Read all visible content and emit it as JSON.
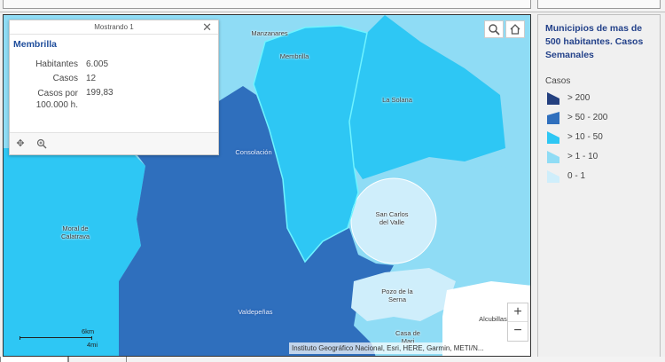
{
  "map": {
    "places": [
      {
        "key": "manzanares",
        "name": "Manzanares",
        "dark": false
      },
      {
        "key": "membrilla",
        "name": "Membrilla",
        "dark": false
      },
      {
        "key": "la_solana",
        "name": "La Solana",
        "dark": false
      },
      {
        "key": "consolacion",
        "name": "Consolación",
        "dark": true
      },
      {
        "key": "san_carlos",
        "name": "San Carlos\ndel Valle",
        "dark": false
      },
      {
        "key": "moral",
        "name": "Moral de\nCalatrava",
        "dark": false
      },
      {
        "key": "valdepenas",
        "name": "Valdepeñas",
        "dark": true
      },
      {
        "key": "pozo",
        "name": "Pozo de la\nSerna",
        "dark": false
      },
      {
        "key": "alcubillas",
        "name": "Alcubillas",
        "dark": false
      },
      {
        "key": "casa_de_mari",
        "name": "Casa de\nMari",
        "dark": false
      }
    ],
    "attribution": "Instituto Geográfico Nacional, Esri, HERE, Garmin, METI/N...",
    "scale_km": "6km",
    "scale_mi": "4mi",
    "zoom_in": "+",
    "zoom_out": "−",
    "colors": {
      "c200": "#2f6fbd",
      "c50_200": "#2f6fbd",
      "c10_50": "#2ec7f4",
      "c1_10": "#8fdcf5",
      "c0_1": "#cfeefb"
    }
  },
  "popup": {
    "header": "Mostrando 1",
    "title": "Membrilla",
    "fields": [
      {
        "label": "Habitantes",
        "value": "6.005"
      },
      {
        "label": "Casos",
        "value": "12"
      },
      {
        "label": "Casos por\n100.000 h.",
        "value": "199,83"
      }
    ],
    "close_icon": "close-icon",
    "move_icon": "move-icon",
    "zoom_to_icon": "zoom-to-icon"
  },
  "legend": {
    "title": "Municipios de mas de 500 habitantes. Casos Semanales",
    "subtitle": "Casos",
    "items": [
      {
        "label": "> 200",
        "color": "#24407f"
      },
      {
        "label": "> 50 - 200",
        "color": "#2f6fbd"
      },
      {
        "label": "> 10 - 50",
        "color": "#2ec7f4"
      },
      {
        "label": "> 1 - 10",
        "color": "#8fdcf5"
      },
      {
        "label": "0 - 1",
        "color": "#cfeefb"
      }
    ]
  }
}
